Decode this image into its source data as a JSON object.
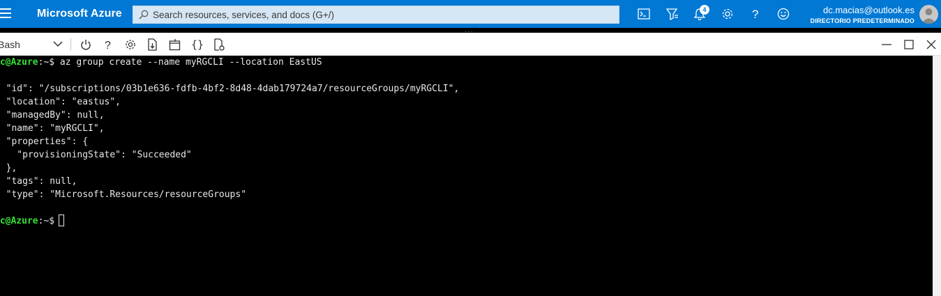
{
  "header": {
    "brand": "Microsoft Azure",
    "search_placeholder": "Search resources, services, and docs (G+/)",
    "notifications_count": "4",
    "user_email": "dc.macias@outlook.es",
    "user_directory": "DIRECTORIO PREDETERMINADO",
    "icons": [
      "menu-icon",
      "search-icon",
      "cloud-shell-icon",
      "directory-filter-icon",
      "notifications-icon",
      "settings-icon",
      "help-icon",
      "feedback-icon",
      "avatar"
    ]
  },
  "toolbar": {
    "shell": "Bash",
    "tools": [
      "power-icon",
      "help-icon",
      "settings-icon",
      "upload-download-icon",
      "open-new-session-icon",
      "braces-icon",
      "web-preview-icon"
    ],
    "window_controls": [
      "minimize-icon",
      "maximize-icon",
      "close-icon"
    ]
  },
  "terminal": {
    "prompt_user": "dc@Azure",
    "prompt_path": ":~$",
    "command": " az group create --name myRGCLI --location EastUS",
    "output_open": "{",
    "output_lines": [
      "  \"id\": \"/subscriptions/03b1e636-fdfb-4bf2-8d48-4dab179724a7/resourceGroups/myRGCLI\",",
      "  \"location\": \"eastus\",",
      "  \"managedBy\": null,",
      "  \"name\": \"myRGCLI\",",
      "  \"properties\": {",
      "    \"provisioningState\": \"Succeeded\"",
      "  },",
      "  \"tags\": null,",
      "  \"type\": \"Microsoft.Resources/resourceGroups\""
    ],
    "output_close": "}",
    "prompt2_user": "dc@Azure",
    "prompt2_path": ":~$"
  },
  "colors": {
    "topbar": "#0078d4",
    "prompt": "#36e036",
    "terminal_bg": "#000000"
  }
}
